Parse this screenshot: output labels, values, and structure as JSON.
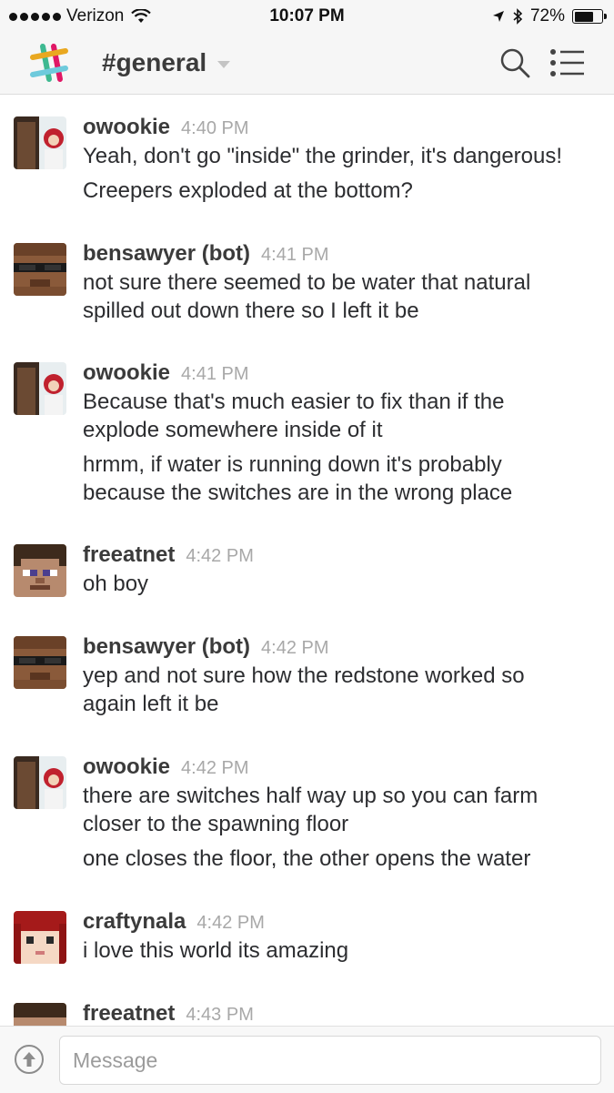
{
  "status_bar": {
    "carrier": "Verizon",
    "time": "10:07 PM",
    "battery": "72%",
    "battery_level": 0.72
  },
  "header": {
    "channel": "#general",
    "icons": [
      "slack-logo-icon",
      "chevron-down-icon",
      "search-icon",
      "list-menu-icon"
    ]
  },
  "messages": [
    {
      "author": "owookie",
      "time": "4:40 PM",
      "lines": [
        "Yeah, don't go \"inside\" the grinder, it's dangerous!",
        "Creepers exploded at the bottom?"
      ]
    },
    {
      "author": "bensawyer (bot)",
      "time": "4:41 PM",
      "lines": [
        "not sure there seemed to be water that natural",
        "spilled out down there so I left it be"
      ]
    },
    {
      "author": "owookie",
      "time": "4:41 PM",
      "lines": [
        "Because that's much easier to fix than if the",
        "explode somewhere inside of it",
        "hrmm, if water is running down it's probably",
        "because the switches are in the wrong place"
      ]
    },
    {
      "author": "freeatnet",
      "time": "4:42 PM",
      "lines": [
        "oh boy"
      ]
    },
    {
      "author": "bensawyer (bot)",
      "time": "4:42 PM",
      "lines": [
        "yep and not sure how the redstone worked so",
        "again left it be"
      ]
    },
    {
      "author": "owookie",
      "time": "4:42 PM",
      "lines": [
        "there are switches half way up so you can farm",
        "closer to the spawning floor",
        "one closes the floor, the other opens the water"
      ]
    },
    {
      "author": "craftynala",
      "time": "4:42 PM",
      "lines": [
        "i love this world its amazing"
      ]
    },
    {
      "author": "freeatnet",
      "time": "4:43 PM",
      "lines": []
    }
  ],
  "composer": {
    "placeholder": "Message",
    "value": ""
  },
  "colors": {
    "header_bg": "#f6f6f6",
    "author": "#3b3b3b",
    "timestamp": "#a8a8a8",
    "text": "#2c2d30"
  }
}
